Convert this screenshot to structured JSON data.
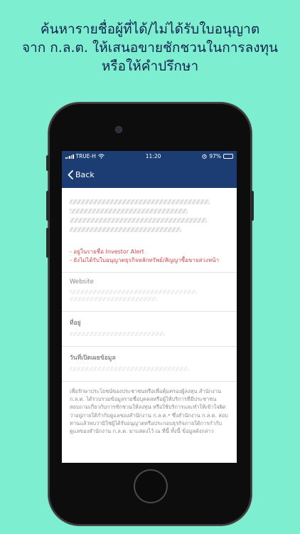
{
  "headline": {
    "line1": "ค้นหารายชื่อผู้ที่ได้/ไม่ได้รับใบอนุญาต",
    "line2": "จาก ก.ล.ต. ให้เสนอขายชักชวนในการลงทุน",
    "line3": "หรือให้คำปรึกษา"
  },
  "status_bar": {
    "carrier": "TRUE-H",
    "time": "11:20",
    "battery_percent": "97%",
    "battery_level": 0.97
  },
  "nav": {
    "back_label": "Back"
  },
  "alert": {
    "line1": "- อยู่ในรายชื่อ Investor Alert",
    "line2": "- ยังไม่ได้รับใบอนุญาตธุรกิจหลักทรัพย์/สัญญาซื้อขายล่วงหน้า"
  },
  "fields": {
    "website_label": "Website",
    "address_label": "ที่อยู่",
    "publish_date_label": "วันที่เปิดเผยข้อมูล"
  },
  "disclaimer": "เพื่อรักษาประโยชน์ของประชาชนหรือเพื่อคุ้มครองผู้ลงทุน สำนักงาน ก.ล.ต. ได้รวบรวมข้อมูลรายชื่อบุคคลหรือผู้ให้บริการที่มีประชาชนสอบถามเกี่ยวกับการชักชวนให้ลงทุน หรือใช้บริการและทำให้เข้าใจผิดว่าอยู่ภายใต้กำกับดูแลของสำนักงาน ก.ล.ต.* ซึ่งสำนักงาน ก.ล.ต. สอบทานแล้วพบว่ามิใช่ผู้ได้รับอนุญาตหรือประกอบธุรกิจภายใต้การกำกับดูแลของสำนักงาน ก.ล.ต. มาแสดงไว้ ณ ที่นี้ ทั้งนี้ ข้อมูลดังกล่าว",
  "colors": {
    "background": "#7eeed0",
    "navbar": "#1c3d73",
    "alert_text": "#d04a4a",
    "headline_text": "#10234f"
  },
  "icons": {
    "back": "chevron-left-icon",
    "wifi": "wifi-icon",
    "alarm": "alarm-icon",
    "battery": "battery-icon",
    "signal": "signal-icon"
  }
}
